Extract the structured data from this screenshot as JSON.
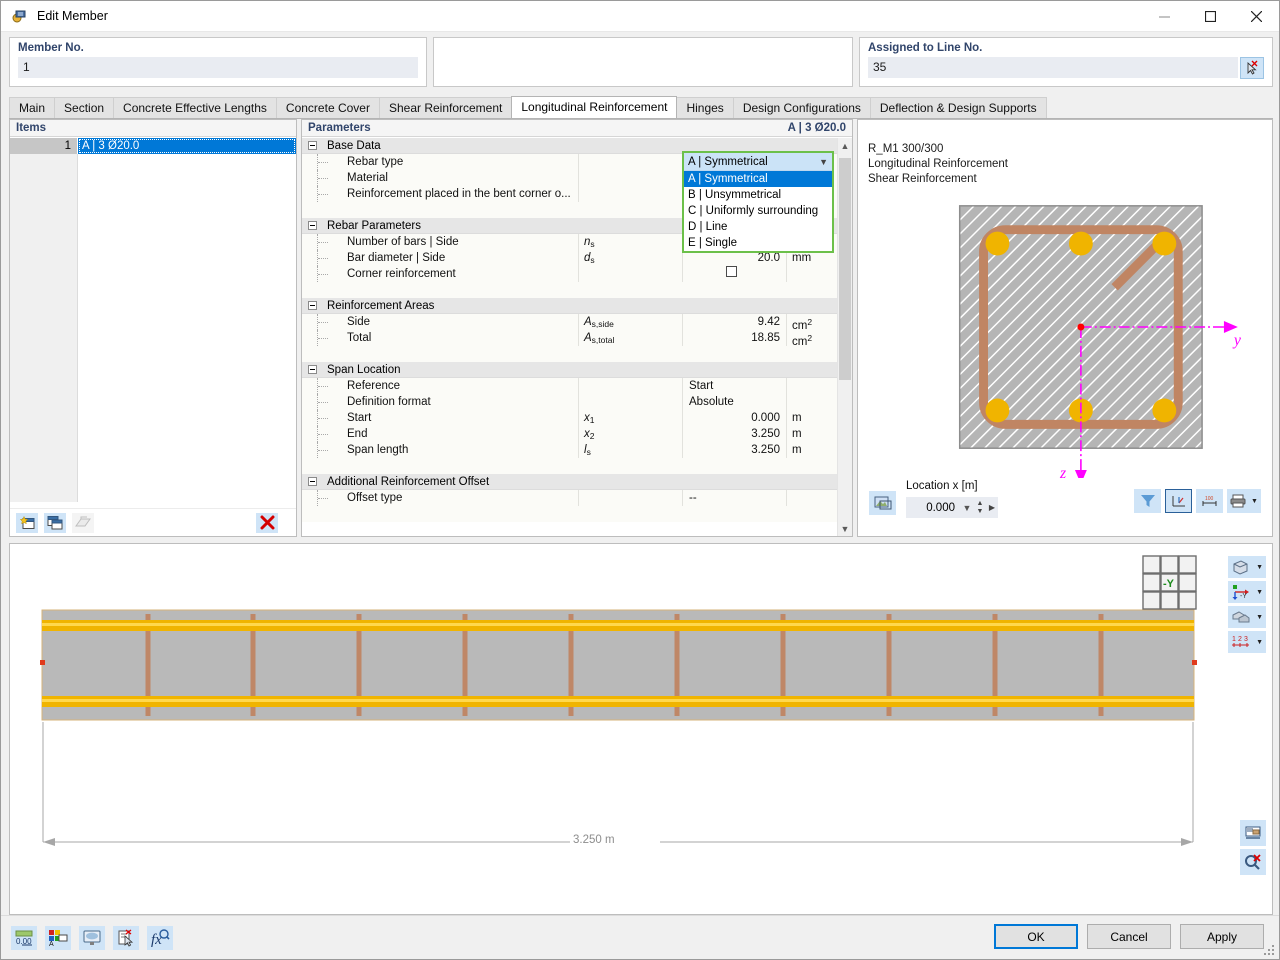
{
  "window": {
    "title": "Edit Member",
    "icon": "member-icon",
    "minimize": "minimize-icon",
    "maximize": "maximize-icon",
    "close": "close-icon"
  },
  "header": {
    "member_no_label": "Member No.",
    "member_no_value": "1",
    "assigned_line_label": "Assigned to Line No.",
    "assigned_line_value": "35",
    "pick_icon": "pick-cursor-icon"
  },
  "tabs": [
    {
      "label": "Main",
      "active": false
    },
    {
      "label": "Section",
      "active": false
    },
    {
      "label": "Concrete Effective Lengths",
      "active": false
    },
    {
      "label": "Concrete Cover",
      "active": false
    },
    {
      "label": "Shear Reinforcement",
      "active": false
    },
    {
      "label": "Longitudinal Reinforcement",
      "active": true
    },
    {
      "label": "Hinges",
      "active": false
    },
    {
      "label": "Design Configurations",
      "active": false
    },
    {
      "label": "Deflection & Design Supports",
      "active": false
    }
  ],
  "items_pane": {
    "header": "Items",
    "rows": [
      {
        "no": "1",
        "value": "A | 3 Ø20.0"
      }
    ],
    "toolbar": {
      "new_icon": "new-item-icon",
      "copy_icon": "copy-item-icon",
      "import_icon": "import-item-icon",
      "delete_icon": "delete-item-icon"
    }
  },
  "params_pane": {
    "header": "Parameters",
    "header_right": "A | 3 Ø20.0",
    "groups": [
      {
        "title": "Base Data",
        "rows": [
          {
            "name": "Rebar type",
            "symbol": "",
            "value": "",
            "unit": ""
          },
          {
            "name": "Material",
            "symbol": "",
            "value": "",
            "unit": ""
          },
          {
            "name": "Reinforcement placed in the bent corner o...",
            "symbol": "",
            "value": "",
            "unit": ""
          }
        ]
      },
      {
        "title": "Rebar Parameters",
        "rows": [
          {
            "name": "Number of bars | Side",
            "symbol": "n",
            "symbol_sub": "s",
            "value": "",
            "unit": ""
          },
          {
            "name": "Bar diameter | Side",
            "symbol": "d",
            "symbol_sub": "s",
            "value": "20.0",
            "unit": "mm"
          },
          {
            "name": "Corner reinforcement",
            "symbol": "",
            "value": "",
            "unit": "",
            "checkbox": true
          }
        ]
      },
      {
        "title": "Reinforcement Areas",
        "rows": [
          {
            "name": "Side",
            "symbol": "A",
            "symbol_sub": "s,side",
            "value": "9.42",
            "unit": "cm²"
          },
          {
            "name": "Total",
            "symbol": "A",
            "symbol_sub": "s,total",
            "value": "18.85",
            "unit": "cm²"
          }
        ]
      },
      {
        "title": "Span Location",
        "rows": [
          {
            "name": "Reference",
            "symbol": "",
            "value": "Start",
            "unit": "",
            "align": "left"
          },
          {
            "name": "Definition format",
            "symbol": "",
            "value": "Absolute",
            "unit": "",
            "align": "left"
          },
          {
            "name": "Start",
            "symbol": "x",
            "symbol_sub": "1",
            "value": "0.000",
            "unit": "m"
          },
          {
            "name": "End",
            "symbol": "x",
            "symbol_sub": "2",
            "value": "3.250",
            "unit": "m"
          },
          {
            "name": "Span length",
            "symbol": "l",
            "symbol_sub": "s",
            "value": "3.250",
            "unit": "m"
          }
        ]
      },
      {
        "title": "Additional Reinforcement Offset",
        "rows": [
          {
            "name": "Offset type",
            "symbol": "",
            "value": "--",
            "unit": "",
            "align": "left"
          }
        ]
      }
    ],
    "scroll_up_icon": "chevron-up-icon",
    "scroll_down_icon": "chevron-down-icon"
  },
  "dropdown": {
    "selected": "A | Symmetrical",
    "caret_icon": "chevron-down-icon",
    "options": [
      {
        "label": "A | Symmetrical",
        "selected": true
      },
      {
        "label": "B | Unsymmetrical",
        "selected": false
      },
      {
        "label": "C | Uniformly surrounding",
        "selected": false
      },
      {
        "label": "D | Line",
        "selected": false
      },
      {
        "label": "E | Single",
        "selected": false
      }
    ],
    "highlight_color": "#6cc04a"
  },
  "view_pane": {
    "caption_lines": [
      "R_M1 300/300",
      "Longitudinal Reinforcement",
      "Shear Reinforcement"
    ],
    "axis_y_label": "y",
    "axis_z_label": "z",
    "location_label": "Location x [m]",
    "location_value": "0.000",
    "snapshot_icon": "snapshot-icon",
    "buttons": [
      {
        "icon": "filter-icon",
        "name": "filter-button",
        "framed": false
      },
      {
        "icon": "axes-icon",
        "name": "show-axes-button",
        "framed": true
      },
      {
        "icon": "dimensions-icon",
        "name": "show-dimensions-button",
        "framed": false
      },
      {
        "icon": "printer-icon",
        "name": "print-button",
        "framed": false
      }
    ],
    "section_colors": {
      "concrete": "#b5b5b5",
      "hatch": "#ffffff",
      "stirrup": "#c08563",
      "bar": "#f0b400",
      "axis": "#ff00ff",
      "origin": "#ff0000"
    }
  },
  "drawing": {
    "dimension_label": "3.250 m",
    "nav_cube_label": "-Y",
    "concrete_color": "#b9b9b9",
    "rebar_color": "#f0b400",
    "stirrup_color": "#c08563",
    "right_tools": [
      {
        "icon": "render-mode-icon",
        "name": "render-mode-dropdown"
      },
      {
        "icon": "view-axes-icon",
        "name": "view-direction-dropdown"
      },
      {
        "icon": "display-mode-icon",
        "name": "display-mode-dropdown"
      },
      {
        "icon": "numbering-icon",
        "name": "numbering-dropdown"
      }
    ],
    "bottom_tools": [
      {
        "icon": "print-preview-icon",
        "name": "print-preview-button"
      },
      {
        "icon": "zoom-reset-icon",
        "name": "zoom-reset-button"
      }
    ]
  },
  "statusbar": {
    "buttons": [
      {
        "icon": "decimal-places-icon",
        "name": "decimal-places-button"
      },
      {
        "icon": "display-properties-icon",
        "name": "display-properties-button"
      },
      {
        "icon": "rendering-icon",
        "name": "rendering-button"
      },
      {
        "icon": "comment-icon",
        "name": "comment-button"
      },
      {
        "icon": "formula-icon",
        "name": "formula-button"
      }
    ],
    "ok": "OK",
    "cancel": "Cancel",
    "apply": "Apply"
  }
}
